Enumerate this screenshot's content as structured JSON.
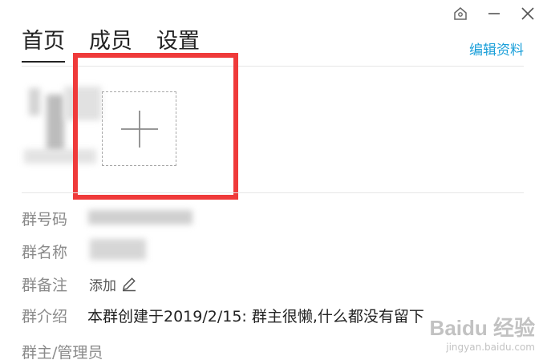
{
  "window": {
    "controls": [
      "pin-icon",
      "minimize-icon",
      "close-icon"
    ]
  },
  "tabs": [
    {
      "label": "首页",
      "active": true
    },
    {
      "label": "成员",
      "active": false
    },
    {
      "label": "设置",
      "active": false
    }
  ],
  "header": {
    "edit_label": "编辑资料"
  },
  "avatar_upload": {
    "icon": "plus-icon"
  },
  "info": {
    "group_id_label": "群号码",
    "group_name_label": "群名称",
    "group_remark_label": "群备注",
    "group_remark_action": "添加",
    "group_intro_label": "群介绍",
    "group_intro_value": "本群创建于2019/2/15:  群主很懒,什么都没有留下",
    "owner_admin_label": "群主/管理员"
  },
  "watermark": {
    "main": "Baidu 经验",
    "sub": "jingyan.baidu.com"
  },
  "colors": {
    "accent": "#1a9fd9",
    "highlight": "#ef3a3a"
  }
}
